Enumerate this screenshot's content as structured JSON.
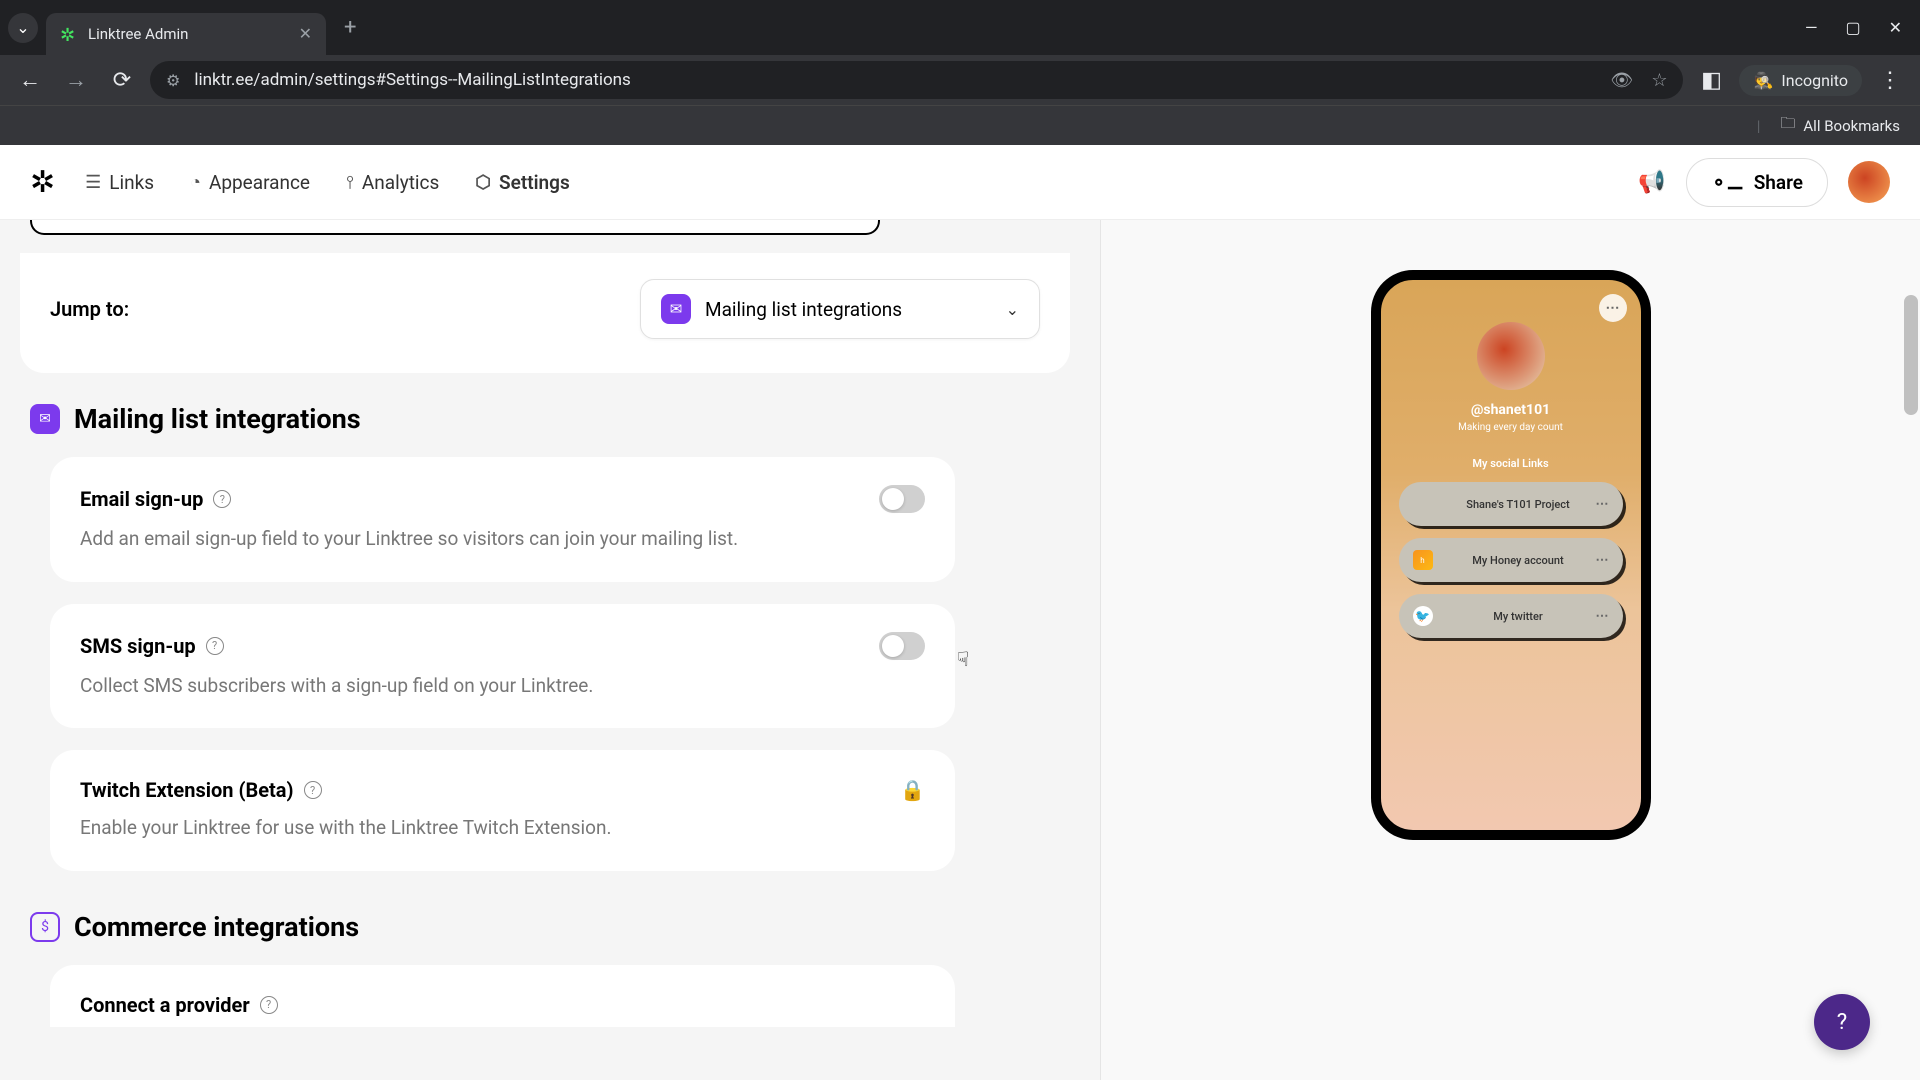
{
  "browser": {
    "tab_title": "Linktree Admin",
    "url": "linktr.ee/admin/settings#Settings--MailingListIntegrations",
    "incognito_label": "Incognito",
    "all_bookmarks": "All Bookmarks"
  },
  "nav": {
    "links": "Links",
    "appearance": "Appearance",
    "analytics": "Analytics",
    "settings": "Settings",
    "share": "Share"
  },
  "jump": {
    "label": "Jump to:",
    "selected": "Mailing list integrations"
  },
  "sections": {
    "mailing": {
      "title": "Mailing list integrations",
      "email": {
        "title": "Email sign-up",
        "desc": "Add an email sign-up field to your Linktree so visitors can join your mailing list."
      },
      "sms": {
        "title": "SMS sign-up",
        "desc": "Collect SMS subscribers with a sign-up field on your Linktree."
      },
      "twitch": {
        "title": "Twitch Extension (Beta)",
        "desc": "Enable your Linktree for use with the Linktree Twitch Extension."
      }
    },
    "commerce": {
      "title": "Commerce integrations",
      "connect": {
        "title": "Connect a provider"
      }
    }
  },
  "preview": {
    "handle": "@shanet101",
    "tagline": "Making every day count",
    "heading": "My social Links",
    "links": [
      {
        "text": "Shane's T101 Project"
      },
      {
        "text": "My Honey account"
      },
      {
        "text": "My twitter"
      }
    ]
  },
  "help_fab": "?"
}
